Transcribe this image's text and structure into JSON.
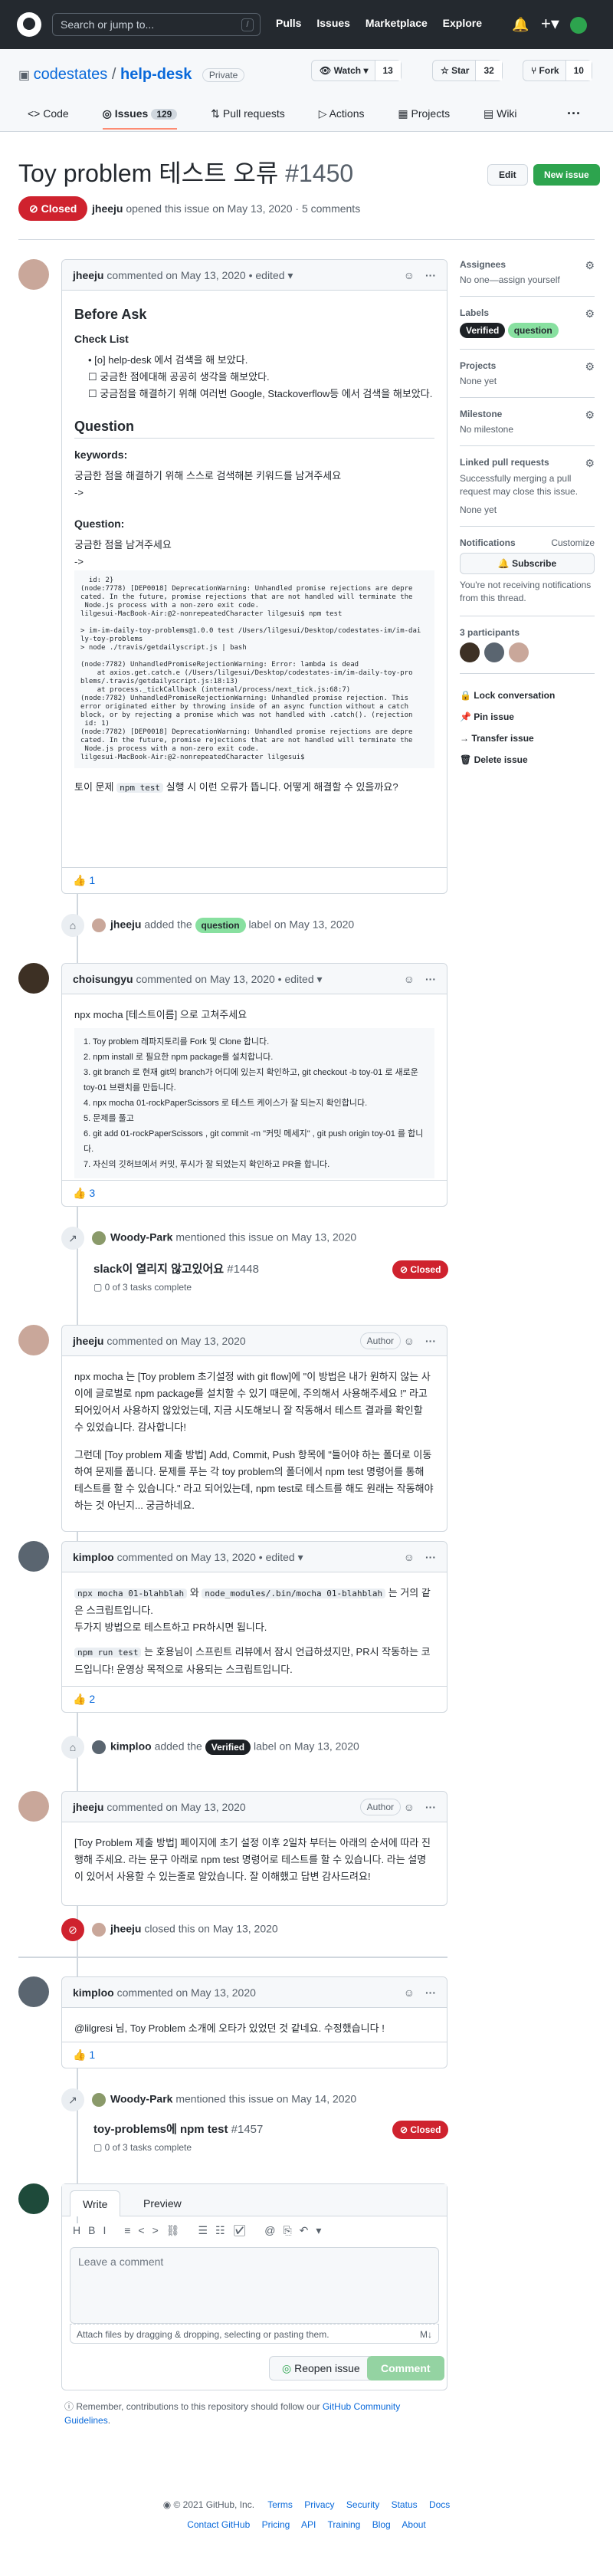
{
  "header": {
    "search_placeholder": "Search or jump to...",
    "slash": "/",
    "nav": [
      "Pulls",
      "Issues",
      "Marketplace",
      "Explore"
    ]
  },
  "repo": {
    "owner": "codestates",
    "sep": "/",
    "name": "help-desk",
    "visibility": "Private",
    "watch_label": "Watch",
    "watch_count": "13",
    "star_label": "Star",
    "star_count": "32",
    "fork_label": "Fork",
    "fork_count": "10",
    "tabs": [
      {
        "label": "Code"
      },
      {
        "label": "Issues",
        "count": "129"
      },
      {
        "label": "Pull requests"
      },
      {
        "label": "Actions"
      },
      {
        "label": "Projects"
      },
      {
        "label": "Wiki"
      }
    ]
  },
  "issue": {
    "title": "Toy problem 테스트 오류",
    "number": "#1450",
    "edit_label": "Edit",
    "new_label": "New issue",
    "state": "Closed",
    "author": "jheeju",
    "opened_text": "opened this issue on May 13, 2020 · 5 comments"
  },
  "comments": {
    "c1": {
      "author": "jheeju",
      "meta": "commented on May 13, 2020 • edited",
      "h_before": "Before Ask",
      "h_checklist": "Check List",
      "check1": "[o] help-desk 에서 검색을 해 보았다.",
      "check2": "궁금한 점에대해 공공히 생각을 해보았다.",
      "check3": "궁금점을 해결하기 위해 여러번 Google, Stackoverflow등 에서 검색을 해보았다.",
      "h_question": "Question",
      "h_keywords": "keywords:",
      "kw_text": "궁금한 점을 해결하기 위해 스스로 검색해본 키워드를 남겨주세요",
      "arrow": "->",
      "h_question2": "Question:",
      "q_text": "궁금한 점을 남겨주세요",
      "q_arrow": "->",
      "code": "  id: 2}\n(node:7778) [DEP0018] DeprecationWarning: Unhandled promise rejections are depre\ncated. In the future, promise rejections that are not handled will terminate the\n Node.js process with a non-zero exit code.\nlilgesui-MacBook-Air:@2-nonrepeatedCharacter lilgesui$ npm test\n\n> im-im-daily-toy-problems@1.0.0 test /Users/lilgesui/Desktop/codestates-im/im-dai\nly-toy-problems\n> node ./travis/getdailyscript.js | bash\n\n(node:7782) UnhandledPromiseRejectionWarning: Error: lambda is dead\n    at axios.get.catch.e (/Users/lilgesui/Desktop/codestates-im/im-daily-toy-pro\nblems/.travis/getdailyscript.js:18:13)\n    at process._tickCallback (internal/process/next_tick.js:68:7)\n(node:7782) UnhandledPromiseRejectionWarning: Unhandled promise rejection. This\nerror originated either by throwing inside of an async function without a catch\nblock, or by rejecting a promise which was not handled with .catch(). (rejection\n id: 1)\n(node:7782) [DEP0018] DeprecationWarning: Unhandled promise rejections are depre\ncated. In the future, promise rejections that are not handled will terminate the\n Node.js process with a non-zero exit code.\nlilgesui-MacBook-Air:@2-nonrepeatedCharacter lilgesui$",
      "footer_pre": "토이 문제",
      "footer_code": "npm test",
      "footer_post": "실행 시 이런 오류가 뜹니다. 어떻게 해결할 수 있을까요?",
      "reaction": "👍 1"
    },
    "ev_label1": {
      "actor": "jheeju",
      "pre": "added the",
      "label": "question",
      "post": "label on May 13, 2020"
    },
    "c2": {
      "author": "choisungyu",
      "meta": "commented on May 13, 2020 • edited",
      "intro": "npx mocha [테스트이름] 으로 고쳐주세요",
      "steps": [
        "1. Toy problem 레파지토리를 Fork 및 Clone 합니다.",
        "2. npm install 로 필요한 npm package를 설치합니다.",
        "3. git branch 로 현재 git의 branch가 어디에 있는지 확인하고, git checkout -b toy-01 로 새로운 toy-01 브랜치를 만듭니다.",
        "4. npx mocha 01-rockPaperScissors 로 테스트 케이스가 잘 되는지 확인합니다.",
        "5. 문제를 풀고",
        "6. git add 01-rockPaperScissors , git commit -m \"커밋 메세지\" , git push origin toy-01 를 합니다.",
        "7. 자신의 깃허브에서 커밋, 푸시가 잘 되었는지 확인하고 PR을 합니다."
      ],
      "reaction": "👍 3"
    },
    "ev_mention1": {
      "actor": "Woody-Park",
      "text": "mentioned this issue on May 13, 2020",
      "ref_title": "slack이 열리지 않고있어요",
      "ref_num": "#1448",
      "ref_state": "Closed",
      "tasks": "0 of 3 tasks complete"
    },
    "c3": {
      "author": "jheeju",
      "meta": "commented on May 13, 2020",
      "badge": "Author",
      "p1": "npx mocha 는 [Toy problem 초기설정 with git flow]에 \"이 방법은 내가 원하지 않는 사이에 글로벌로 npm package를 설치할 수 있기 때문에, 주의해서 사용해주세요 !\" 라고 되어있어서 사용하지 않았었는데, 지금 시도해보니 잘 작동해서 테스트 결과를 확인할 수 있었습니다. 감사합니다!",
      "p2": "그런데 [Toy problem 제출 방법] Add, Commit, Push 항목에 \"들어야 하는 폴더로 이동하여 문제를 풉니다. 문제를 푸는 각 toy problem의 폴더에서 npm test 명령어를 통해 테스트를 할 수 있습니다.\" 라고 되어있는데, npm test로 테스트를 해도 원래는 작동해야 하는 것 아닌지... 궁금하네요."
    },
    "c4": {
      "author": "kimploo",
      "meta": "commented on May 13, 2020 • edited",
      "code1": "npx mocha 01-blahblah",
      "mid1": "와",
      "code2": "node_modules/.bin/mocha 01-blahblah",
      "post1": "는 거의 같은 스크립트입니다.",
      "p2": "두가지 방법으로 테스트하고 PR하시면 됩니다.",
      "code3": "npm run test",
      "p3": "는 호용님이 스프린트 리뷰에서 잠시 언급하셨지만, PR시 작동하는 코드입니다! 운영상 목적으로 사용되는 스크립트입니다.",
      "reaction": "👍 2"
    },
    "ev_label2": {
      "actor": "kimploo",
      "pre": "added the",
      "label": "Verified",
      "post": "label on May 13, 2020"
    },
    "c5": {
      "author": "jheeju",
      "meta": "commented on May 13, 2020",
      "badge": "Author",
      "p1": "[Toy Problem 제출 방법] 페이지에 초기 설정 이후 2일차 부터는 아래의 순서에 따라 진행해 주세요. 라는 문구 아래로 npm test 명령어로 테스트를 할 수 있습니다. 라는 설명이 있어서 사용할 수 있는줄로 알았습니다. 잘 이해했고 답변 감사드려요!"
    },
    "ev_closed": {
      "actor": "jheeju",
      "text": "closed this on May 13, 2020"
    },
    "c6": {
      "author": "kimploo",
      "meta": "commented on May 13, 2020",
      "p1": "@lilgresi 님, Toy Problem 소개에 오타가 있었던 것 같네요. 수정했습니다 !",
      "reaction": "👍 1"
    },
    "ev_mention2": {
      "actor": "Woody-Park",
      "text": "mentioned this issue on May 14, 2020",
      "ref_title": "toy-problems에 npm test",
      "ref_num": "#1457",
      "ref_state": "Closed",
      "tasks": "0 of 3 tasks complete"
    }
  },
  "sidebar": {
    "assignees_h": "Assignees",
    "assignees_v": "No one—assign yourself",
    "labels_h": "Labels",
    "labels": [
      {
        "name": "Verified",
        "color": "#1d2125",
        "text": "#ffffff"
      },
      {
        "name": "question",
        "color": "#88e0a0",
        "text": "#24292f"
      }
    ],
    "projects_h": "Projects",
    "projects_v": "None yet",
    "milestone_h": "Milestone",
    "milestone_v": "No milestone",
    "linked_h": "Linked pull requests",
    "linked_desc": "Successfully merging a pull request may close this issue.",
    "linked_v": "None yet",
    "notif_h": "Notifications",
    "customize": "Customize",
    "subscribe": "Subscribe",
    "notif_desc": "You're not receiving notifications from this thread.",
    "participants": "3 participants",
    "lock": "Lock conversation",
    "pin": "Pin issue",
    "transfer": "Transfer issue",
    "delete": "Delete issue"
  },
  "editor": {
    "write": "Write",
    "preview": "Preview",
    "placeholder": "Leave a comment",
    "attach": "Attach files by dragging & dropping, selecting or pasting them.",
    "reopen": "Reopen issue",
    "comment": "Comment",
    "note_pre": "Remember, contributions to this repository should follow our",
    "note_link": "GitHub Community Guidelines",
    "note_post": "."
  },
  "footer": {
    "copyright": "© 2021 GitHub, Inc.",
    "row1": [
      "Terms",
      "Privacy",
      "Security",
      "Status",
      "Docs"
    ],
    "row2": [
      "Contact GitHub",
      "Pricing",
      "API",
      "Training",
      "Blog",
      "About"
    ]
  },
  "colors": {
    "closed": "#cf222e",
    "primary": "#2da44e",
    "link": "#0969da"
  }
}
